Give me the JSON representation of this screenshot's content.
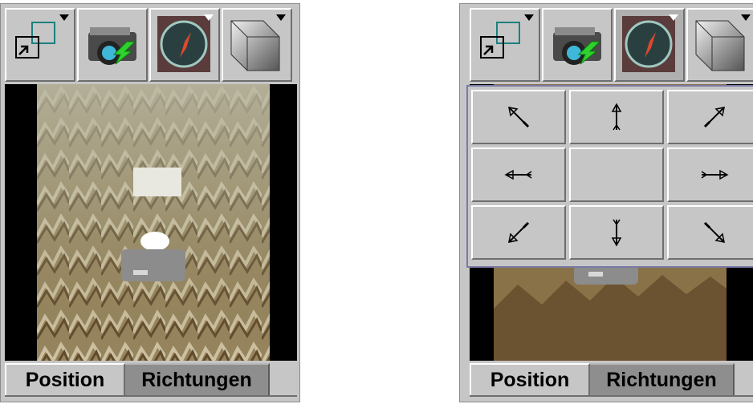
{
  "left_panel": {
    "toolbar": {
      "items": [
        {
          "name": "view-mode",
          "icon": "window-overlap-icon",
          "has_dropdown": true
        },
        {
          "name": "snapshot",
          "icon": "camera-icon"
        },
        {
          "name": "compass",
          "icon": "compass-icon",
          "has_dropdown": true
        },
        {
          "name": "perspective",
          "icon": "3d-box-icon",
          "has_dropdown": true
        }
      ]
    },
    "map": {
      "type": "terrain-relief-map"
    },
    "tabs": [
      {
        "label": "Position",
        "selected": true
      },
      {
        "label": "Richtungen",
        "selected": false
      }
    ]
  },
  "right_panel": {
    "toolbar": {
      "items": [
        {
          "name": "view-mode",
          "icon": "window-overlap-icon",
          "has_dropdown": true
        },
        {
          "name": "snapshot",
          "icon": "camera-icon"
        },
        {
          "name": "compass",
          "icon": "compass-icon",
          "has_dropdown": true,
          "active": true
        },
        {
          "name": "perspective",
          "icon": "3d-box-icon",
          "has_dropdown": true
        }
      ]
    },
    "direction_popup": {
      "buttons": [
        {
          "direction": "north-west",
          "icon": "arrow-nw-icon"
        },
        {
          "direction": "north",
          "icon": "arrow-n-icon"
        },
        {
          "direction": "north-east",
          "icon": "arrow-ne-icon"
        },
        {
          "direction": "west",
          "icon": "arrow-w-icon"
        },
        {
          "direction": "center",
          "icon": ""
        },
        {
          "direction": "east",
          "icon": "arrow-e-icon"
        },
        {
          "direction": "south-west",
          "icon": "arrow-sw-icon"
        },
        {
          "direction": "south",
          "icon": "arrow-s-icon"
        },
        {
          "direction": "south-east",
          "icon": "arrow-se-icon"
        }
      ]
    },
    "tabs": [
      {
        "label": "Position",
        "selected": true
      },
      {
        "label": "Richtungen",
        "selected": false
      }
    ]
  },
  "colors": {
    "panel_bg": "#c6c6c6",
    "tab_inactive": "#8e8e8e",
    "popup_border": "#7a7aa6",
    "compass_needle": "#e0482e",
    "camera_arrow": "#2fd12f"
  }
}
